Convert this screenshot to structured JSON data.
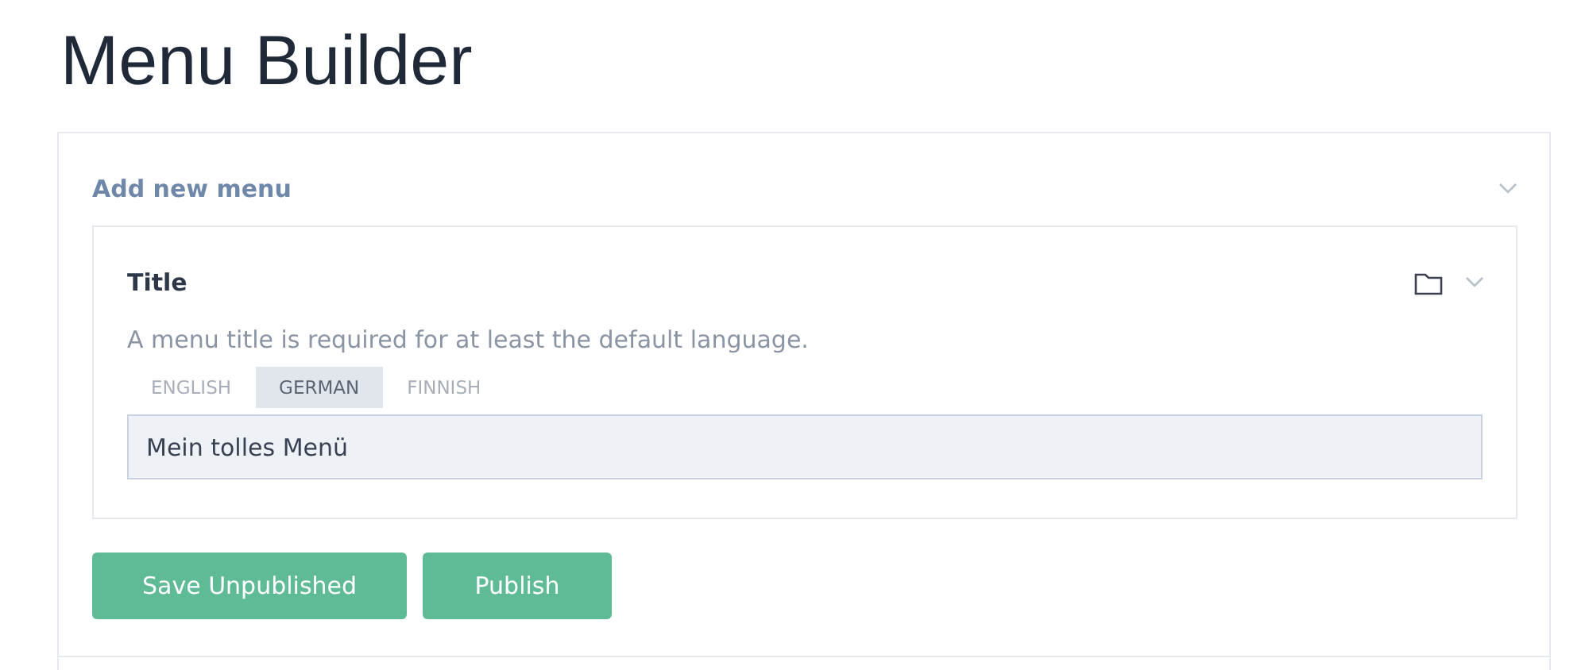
{
  "page_title": "Menu Builder",
  "section": {
    "title": "Add new menu",
    "expanded": true
  },
  "field": {
    "label": "Title",
    "hint": "A menu title is required for at least the default language.",
    "tabs": [
      {
        "label": "ENGLISH",
        "selected": false
      },
      {
        "label": "GERMAN",
        "selected": true
      },
      {
        "label": "FINNISH",
        "selected": false
      }
    ],
    "value": "Mein tolles Menü"
  },
  "buttons": [
    "Save Unpublished",
    "Publish"
  ]
}
